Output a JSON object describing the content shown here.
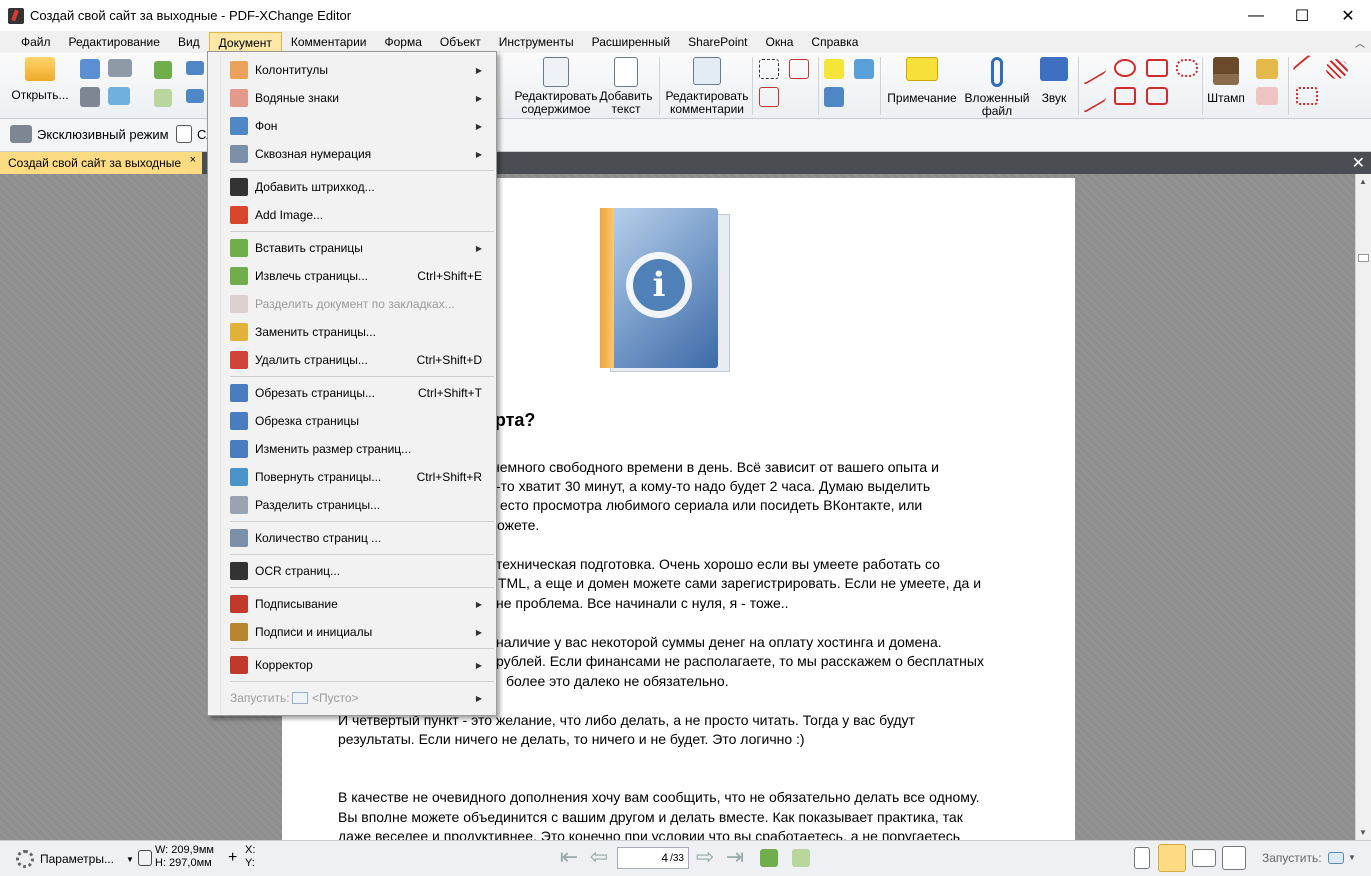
{
  "window": {
    "title": "Создай свой сайт за выходные - PDF-XChange Editor",
    "minimize": "—",
    "maximize": "☐",
    "close": "✕"
  },
  "menubar": [
    "Файл",
    "Редактирование",
    "Вид",
    "Документ",
    "Комментарии",
    "Форма",
    "Объект",
    "Инструменты",
    "Расширенный",
    "SharePoint",
    "Окна",
    "Справка"
  ],
  "menubar_collapse": "︿",
  "ribbon": {
    "open_label": "Открыть...",
    "edit_content_l1": "Редактировать",
    "edit_content_l2": "содержимое",
    "add_text_l1": "Добавить",
    "add_text_l2": "текст",
    "edit_comments_l1": "Редактировать",
    "edit_comments_l2": "комментарии",
    "note_label": "Примечание",
    "attached_l1": "Вложенный",
    "attached_l2": "файл",
    "sound_label": "Звук",
    "stamp_label": "Штамп"
  },
  "toolbar2": {
    "exclusive_mode": "Эксклюзивный режим",
    "partial": "Сл"
  },
  "tabs": {
    "doc_tab": "Создай свой сайт за выходные",
    "close_tab": "×",
    "close_all": "✕"
  },
  "document_menu": {
    "items": [
      {
        "label": "Колонтитулы",
        "shortcut": "",
        "submenu": true,
        "disabled": false,
        "icon": "header-footer-icon",
        "color": "#e9a15b"
      },
      {
        "label": "Водяные знаки",
        "shortcut": "",
        "submenu": true,
        "disabled": false,
        "icon": "watermark-icon",
        "color": "#e49a8a"
      },
      {
        "label": "Фон",
        "shortcut": "",
        "submenu": true,
        "disabled": false,
        "icon": "background-icon",
        "color": "#4f86c6"
      },
      {
        "label": "Сквозная нумерация",
        "shortcut": "",
        "submenu": true,
        "disabled": false,
        "icon": "bates-numbering-icon",
        "color": "#7a8fa8"
      },
      {
        "label": "Добавить штрихкод...",
        "shortcut": "",
        "submenu": false,
        "disabled": false,
        "icon": "barcode-icon",
        "color": "#333333"
      },
      {
        "label": "Add Image...",
        "shortcut": "",
        "submenu": false,
        "disabled": false,
        "icon": "add-image-icon",
        "color": "#d9462e"
      },
      {
        "label": "Вставить страницы",
        "shortcut": "",
        "submenu": true,
        "disabled": false,
        "icon": "insert-pages-icon",
        "color": "#6fae4a"
      },
      {
        "label": "Извлечь страницы...",
        "shortcut": "Ctrl+Shift+E",
        "submenu": false,
        "disabled": false,
        "icon": "extract-pages-icon",
        "color": "#6fae4a"
      },
      {
        "label": "Разделить документ по закладках...",
        "shortcut": "",
        "submenu": false,
        "disabled": true,
        "icon": "split-bookmarks-icon",
        "color": "#c7a6a6"
      },
      {
        "label": "Заменить страницы...",
        "shortcut": "",
        "submenu": false,
        "disabled": false,
        "icon": "replace-pages-icon",
        "color": "#e0b23c"
      },
      {
        "label": "Удалить страницы...",
        "shortcut": "Ctrl+Shift+D",
        "submenu": false,
        "disabled": false,
        "icon": "delete-pages-icon",
        "color": "#d0453a"
      },
      {
        "label": "Обрезать страницы...",
        "shortcut": "Ctrl+Shift+T",
        "submenu": false,
        "disabled": false,
        "icon": "crop-pages-icon",
        "color": "#4a7cc0"
      },
      {
        "label": "Обрезка страницы",
        "shortcut": "",
        "submenu": false,
        "disabled": false,
        "icon": "crop-page-icon",
        "color": "#4a7cc0"
      },
      {
        "label": "Изменить размер страниц...",
        "shortcut": "",
        "submenu": false,
        "disabled": false,
        "icon": "resize-pages-icon",
        "color": "#4a7cc0"
      },
      {
        "label": "Повернуть страницы...",
        "shortcut": "Ctrl+Shift+R",
        "submenu": false,
        "disabled": false,
        "icon": "rotate-pages-icon",
        "color": "#4a94c9"
      },
      {
        "label": "Разделить страницы...",
        "shortcut": "",
        "submenu": false,
        "disabled": false,
        "icon": "split-pages-icon",
        "color": "#9aa4b0"
      },
      {
        "label": "Количество страниц ...",
        "shortcut": "",
        "submenu": false,
        "disabled": false,
        "icon": "page-count-icon",
        "color": "#7a8fa8"
      },
      {
        "label": "OCR страниц...",
        "shortcut": "",
        "submenu": false,
        "disabled": false,
        "icon": "ocr-icon",
        "color": "#333333"
      },
      {
        "label": "Подписывание",
        "shortcut": "",
        "submenu": true,
        "disabled": false,
        "icon": "signing-icon",
        "color": "#c0392b"
      },
      {
        "label": "Подписи и инициалы",
        "shortcut": "",
        "submenu": true,
        "disabled": false,
        "icon": "signatures-icon",
        "color": "#b8862e"
      },
      {
        "label": "Корректор",
        "shortcut": "",
        "submenu": true,
        "disabled": false,
        "icon": "redaction-icon",
        "color": "#c0392b"
      },
      {
        "label": "Запустить:",
        "shortcut": "",
        "submenu": true,
        "disabled": true,
        "icon": "",
        "color": ""
      }
    ],
    "run_value": "<Пусто>"
  },
  "page_content": {
    "heading_fragment": "тарта?",
    "paragraphs": [
      "немного свободного времени в день. Всё зависит от вашего опыта и",
      "-то хватит 30 минут, а кому-то надо будет 2 часа. Думаю выделить",
      "есто просмотра любимого сериала или посидеть ВКонтакте, или",
      "ожете.",
      "техническая подготовка. Очень хорошо если вы умеете работать со",
      "TML, а еще и домен можете сами зарегистрировать. Если не умеете, да и",
      "не проблема. Все начинали с нуля, я - тоже..",
      "наличие у вас некоторой суммы денег на оплату хостинга и домена.",
      "рублей. Если финансами не располагаете, то мы расскажем о бесплатных",
      "более это далеко не обязательно.",
      "И четвертый пункт - это желание, что либо делать, а не просто читать. Тогда у вас будут",
      "результаты. Если ничего не делать, то ничего и не будет. Это логично :)",
      "В качестве не очевидного дополнения хочу вам сообщить, что не обязательно делать все одному.",
      "Вы вполне можете объединится с вашим другом и делать вместе. Как показывает практика, так",
      "даже веселее и продуктивнее. Это конечно при условии что вы сработаетесь, а не поругаетесь"
    ]
  },
  "statusbar": {
    "params": "Параметры...",
    "width": "W: 209,9мм",
    "height": "H: 297,0мм",
    "x": "X:",
    "y": "Y:",
    "page_current": "4",
    "page_total": "/33",
    "run": "Запустить:"
  },
  "colors": {
    "menu_highlight": "#fde8a8",
    "tab_active": "#fcdb83",
    "tab_strip": "#4a4d52",
    "workspace": "#8e8e8e"
  }
}
